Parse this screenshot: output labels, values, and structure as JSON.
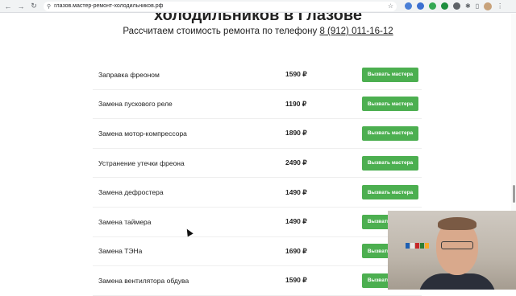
{
  "browser": {
    "url": "глазов.мастер-ремонт-холодильников.рф"
  },
  "header": {
    "title_partial": "холодильников в Глазове",
    "subtitle_prefix": "Рассчитаем стоимость ремонта по телефону",
    "phone": "8 (912) 011-16-12"
  },
  "services": [
    {
      "name": "Заправка фреоном",
      "price": "1590 ₽",
      "button": "Вызвать мастера"
    },
    {
      "name": "Замена пускового реле",
      "price": "1190 ₽",
      "button": "Вызвать мастера"
    },
    {
      "name": "Замена мотор-компрессора",
      "price": "1890 ₽",
      "button": "Вызвать мастера"
    },
    {
      "name": "Устранение утечки фреона",
      "price": "2490 ₽",
      "button": "Вызвать мастера"
    },
    {
      "name": "Замена дефростера",
      "price": "1490 ₽",
      "button": "Вызвать мастера"
    },
    {
      "name": "Замена таймера",
      "price": "1490 ₽",
      "button": "Вызвать мастера"
    },
    {
      "name": "Замена ТЭНа",
      "price": "1690 ₽",
      "button": "Вызвать мастера"
    },
    {
      "name": "Замена вентилятора обдува",
      "price": "1590 ₽",
      "button": "Вызвать мастера"
    }
  ],
  "colors": {
    "button_bg": "#4caf50",
    "button_text": "#ffffff"
  }
}
